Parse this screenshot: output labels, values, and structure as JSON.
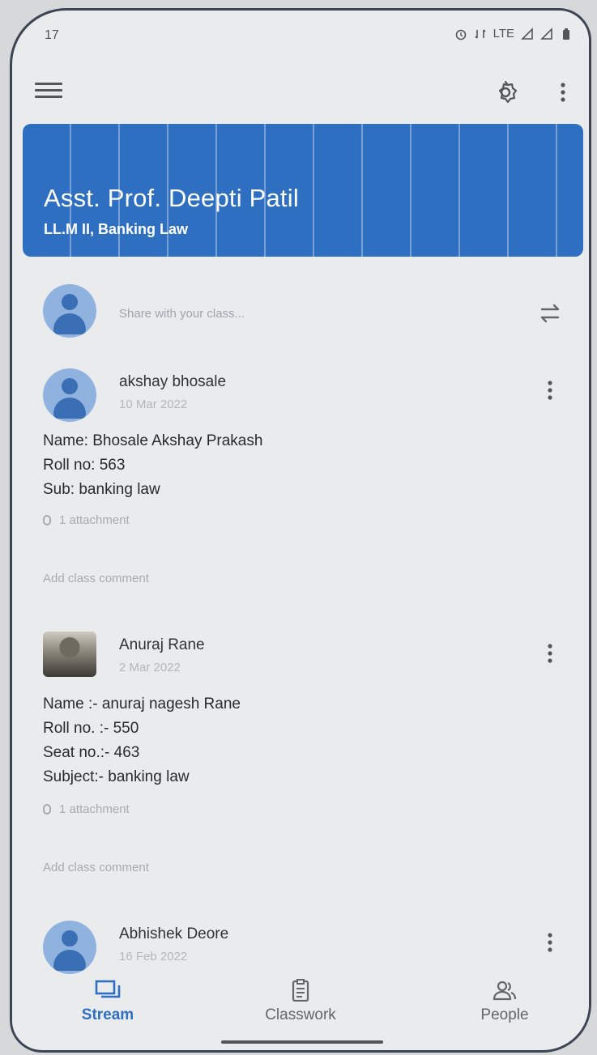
{
  "status_bar": {
    "time": "17",
    "network_label": "LTE"
  },
  "banner": {
    "title": "Asst. Prof. Deepti Patil",
    "subtitle": "LL.M II, Banking Law",
    "color": "#2f6fc2"
  },
  "share": {
    "placeholder": "Share with your class..."
  },
  "posts": [
    {
      "author": "akshay bhosale",
      "date": "10 Mar 2022",
      "lines": [
        "Name: Bhosale Akshay Prakash",
        "Roll no: 563",
        "Sub: banking law"
      ],
      "attachment": "1 attachment",
      "comment_placeholder": "Add class comment"
    },
    {
      "author": "Anuraj Rane",
      "date": "2 Mar 2022",
      "lines": [
        "Name :- anuraj nagesh Rane",
        "Roll no. :- 550",
        "Seat no.:- 463",
        "Subject:- banking law"
      ],
      "attachment": "1 attachment",
      "comment_placeholder": "Add class comment"
    },
    {
      "author": "Abhishek Deore",
      "date": "16 Feb 2022"
    }
  ],
  "bottom_nav": {
    "items": [
      {
        "label": "Stream",
        "icon": "stream-icon",
        "active": true
      },
      {
        "label": "Classwork",
        "icon": "classwork-icon",
        "active": false
      },
      {
        "label": "People",
        "icon": "people-icon",
        "active": false
      }
    ],
    "accent": "#2f6fc2"
  }
}
